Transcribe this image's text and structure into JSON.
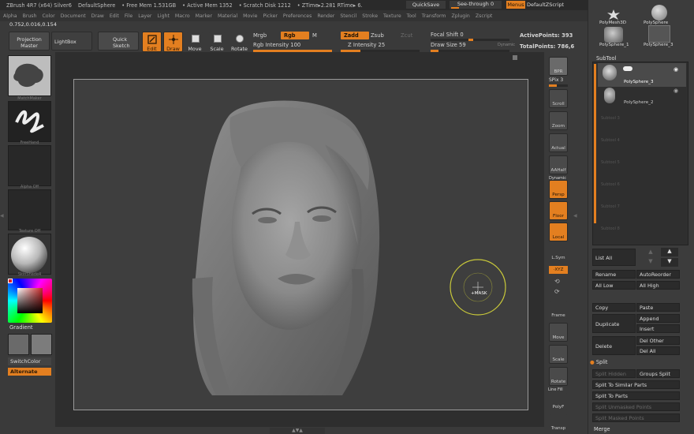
{
  "titlebar": {
    "app": "ZBrush 4R7 (x64) Silver6",
    "document": "DefaultSphere",
    "free_mem": "• Free Mem 1.531GB",
    "active_mem": "• Active Mem 1352",
    "scratch": "• Scratch Disk 1212",
    "ztime": "• ZTime▸2.281 RTime▸ 6.",
    "quicksave": "QuickSave",
    "seethrough": "See-through  0",
    "menus": "Menus",
    "defaultzscript": "DefaultZScript"
  },
  "menubar": [
    "Alpha",
    "Brush",
    "Color",
    "Document",
    "Draw",
    "Edit",
    "File",
    "Layer",
    "Light",
    "Macro",
    "Marker",
    "Material",
    "Movie",
    "Picker",
    "Preferences",
    "Render",
    "Stencil",
    "Stroke",
    "Texture",
    "Tool",
    "Transform",
    "Zplugin",
    "Zscript"
  ],
  "coords": "0.752,0.016,0.154",
  "toolbar": {
    "projection_master": "Projection Master",
    "lightbox": "LightBox",
    "quick_sketch": "Quick Sketch",
    "edit": "Edit",
    "draw": "Draw",
    "move": "Move",
    "scale": "Scale",
    "rotate": "Rotate",
    "mrgb": "Mrgb",
    "rgb": "Rgb",
    "m": "M",
    "rgb_intensity": "Rgb Intensity 100",
    "rgb_intensity_value": 1.0,
    "zadd": "Zadd",
    "zsub": "Zsub",
    "zcut": "Zcut",
    "z_intensity": "Z Intensity 25",
    "z_intensity_value": 0.25,
    "focal_shift": "Focal Shift 0",
    "focal_shift_value": 0.5,
    "draw_size": "Draw Size 59",
    "draw_size_value": 0.1,
    "dynamic": "Dynamic",
    "active_points": "ActivePoints: 393",
    "total_points": "TotalPoints: 786,6"
  },
  "lefttray": {
    "brush_caption": "MatchMaker",
    "stroke_caption": "FreeHand",
    "alpha_caption": "Alpha Off",
    "texture_caption": "Texture Off",
    "material_caption": "SkinShade4",
    "gradient": "Gradient",
    "switchcolor": "SwitchColor",
    "alternate": "Alternate"
  },
  "canvas": {
    "cursor_label": "+MASK"
  },
  "rightshelf": {
    "bpr": "BPR",
    "spix": "SPix 3",
    "scroll": "Scroll",
    "zoom": "Zoom",
    "actual": "Actual",
    "aahalf": "AAHalf",
    "dynamic": "Dynamic",
    "persp": "Persp",
    "floor": "Floor",
    "local": "Local",
    "lsym": "L.Sym",
    "xyz": "·XYZ",
    "frame": "Frame",
    "move": "Move",
    "scale": "Scale",
    "rotate": "Rotate",
    "linefill": "Line Fill",
    "polyf": "PolyF",
    "transp": "Transp"
  },
  "panel": {
    "tool1": "PolyMesh3D",
    "tool2": "PolySphere",
    "tool3": "PolySphere_1",
    "tool4": "PolySphere_3",
    "subtool_title": "SubTool",
    "sub1": "PolySphere_3",
    "sub2": "PolySphere_2",
    "empty_slots": [
      "Subtool 3",
      "Subtool 4",
      "Subtool 5",
      "Subtool 6",
      "Subtool 7",
      "Subtool 8"
    ],
    "list_all": "List All",
    "rename": "Rename",
    "autoreorder": "AutoReorder",
    "all_low": "All Low",
    "all_high": "All High",
    "copy": "Copy",
    "paste": "Paste",
    "duplicate": "Duplicate",
    "append": "Append",
    "insert": "Insert",
    "delete": "Delete",
    "del_other": "Del Other",
    "del_all": "Del All",
    "split_section": "Split",
    "split_hidden": "Split Hidden",
    "groups_split": "Groups Split",
    "split_similar": "Split To Similar Parts",
    "split_parts": "Split To Parts",
    "split_unmasked": "Split Unmasked Points",
    "split_masked": "Split Masked Points",
    "merge": "Merge"
  },
  "colors": {
    "accent": "#e37f20",
    "bg": "#3a3a3a",
    "canvas": "#3e3e3e"
  }
}
